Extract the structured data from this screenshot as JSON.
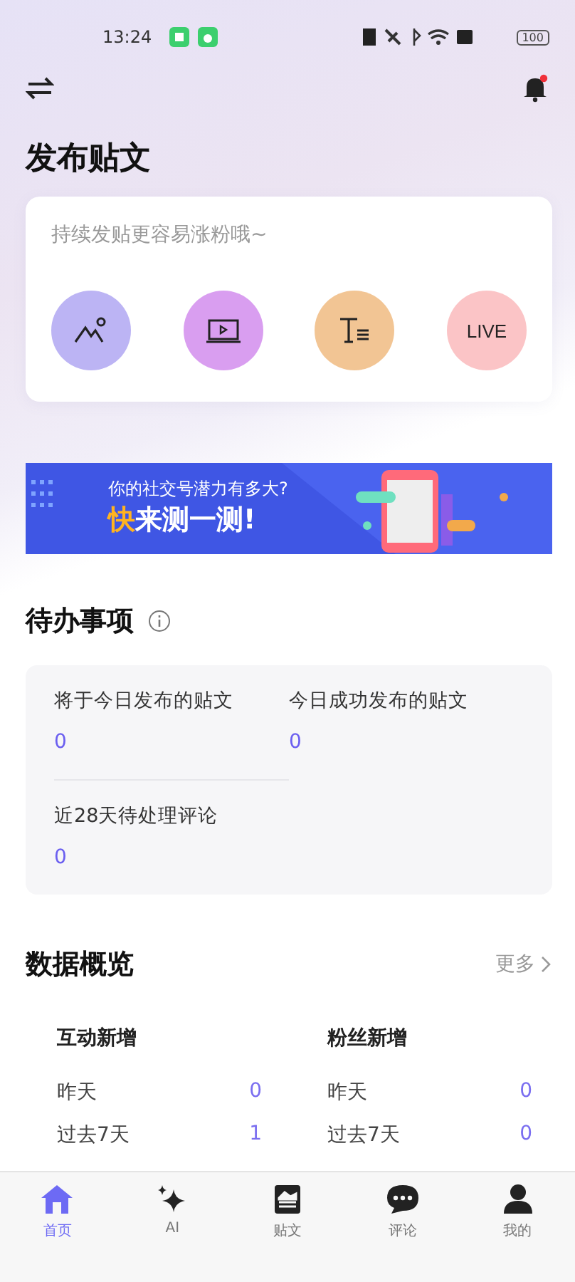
{
  "status_bar": {
    "time": "13:24",
    "battery": "100"
  },
  "publish": {
    "title": "发布贴文",
    "hint": "持续发贴更容易涨粉哦~",
    "actions": [
      {
        "kind": "image",
        "color": "#bcb4f4"
      },
      {
        "kind": "video",
        "color": "#d99ef0"
      },
      {
        "kind": "text",
        "color": "#f2c594"
      },
      {
        "kind": "live",
        "color": "#fbc4c6",
        "label": "LIVE"
      }
    ]
  },
  "banner": {
    "line_1": "你的社交号潜力有多大?",
    "line_2_accent": "快",
    "line_2": "来测一测!"
  },
  "todo": {
    "title": "待办事项",
    "items": [
      {
        "label": "将于今日发布的贴文",
        "value": "0"
      },
      {
        "label": "今日成功发布的贴文",
        "value": "0"
      },
      {
        "label": "近28天待处理评论",
        "value": "0"
      }
    ]
  },
  "overview": {
    "title": "数据概览",
    "more": "更多",
    "groups": [
      {
        "title": "互动新增",
        "rows": [
          {
            "label": "昨天",
            "value": "0"
          },
          {
            "label": "过去7天",
            "value": "1"
          }
        ]
      },
      {
        "title": "粉丝新增",
        "rows": [
          {
            "label": "昨天",
            "value": "0"
          },
          {
            "label": "过去7天",
            "value": "0"
          }
        ]
      }
    ]
  },
  "nav": [
    {
      "kind": "home",
      "label": "首页",
      "selected": true
    },
    {
      "kind": "ai",
      "label": "AI",
      "selected": false
    },
    {
      "kind": "post",
      "label": "贴文",
      "selected": false
    },
    {
      "kind": "comment",
      "label": "评论",
      "selected": false
    },
    {
      "kind": "me",
      "label": "我的",
      "selected": false
    }
  ]
}
